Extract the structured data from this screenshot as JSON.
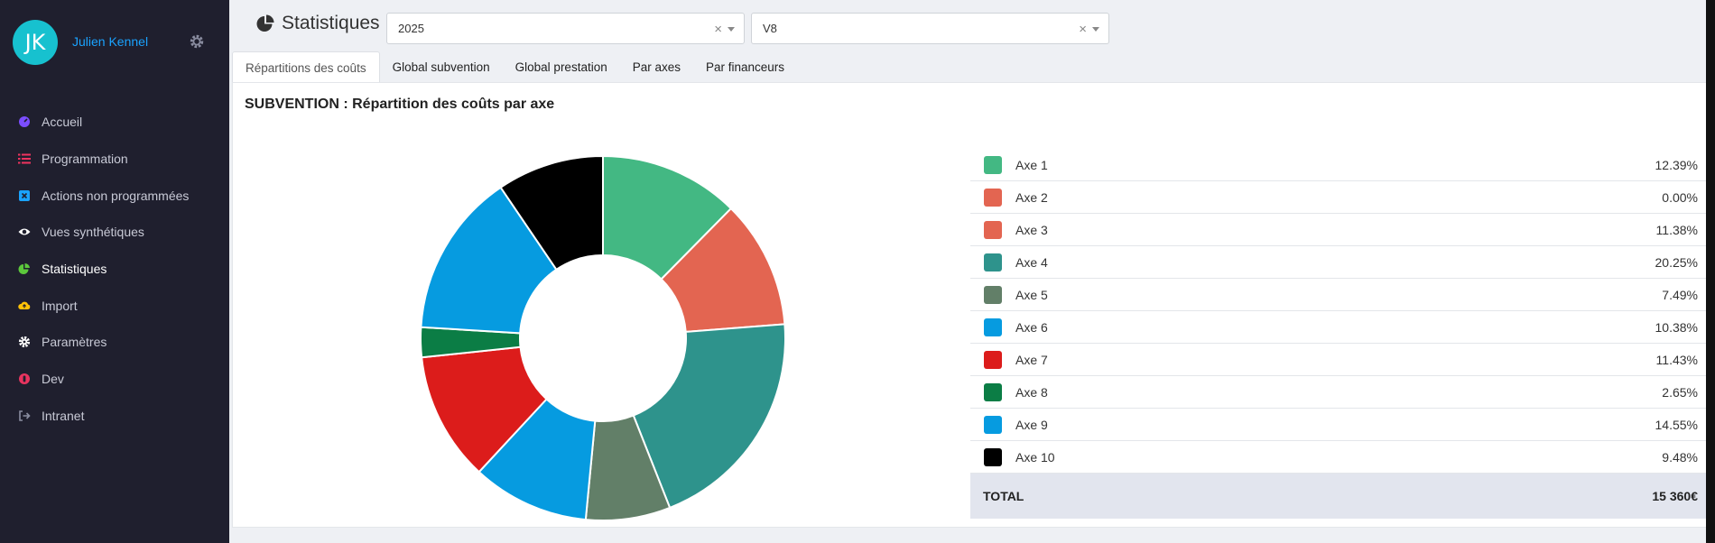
{
  "user": {
    "initials": "JK",
    "name": "Julien Kennel"
  },
  "nav": [
    {
      "label": "Accueil",
      "icon": "dashboard-icon",
      "color": "#7b4dff"
    },
    {
      "label": "Programmation",
      "icon": "list-icon",
      "color": "#f0335f"
    },
    {
      "label": "Actions non programmées",
      "icon": "square-x-icon",
      "color": "#1aa3ff"
    },
    {
      "label": "Vues synthétiques",
      "icon": "eye-icon",
      "color": "#ffffff"
    },
    {
      "label": "Statistiques",
      "icon": "pie-chart-icon",
      "color": "#5cc83c"
    },
    {
      "label": "Import",
      "icon": "cloud-upload-icon",
      "color": "#ffc107"
    },
    {
      "label": "Paramètres",
      "icon": "cog-icon",
      "color": "#ffffff"
    },
    {
      "label": "Dev",
      "icon": "bug-icon",
      "color": "#e8345f"
    },
    {
      "label": "Intranet",
      "icon": "sign-out-icon",
      "color": "#8a8da0"
    }
  ],
  "header": {
    "title": "Statistiques",
    "year_value": "2025",
    "version_value": "V8"
  },
  "tabs": [
    {
      "label": "Répartitions des coûts"
    },
    {
      "label": "Global subvention"
    },
    {
      "label": "Global prestation"
    },
    {
      "label": "Par axes"
    },
    {
      "label": "Par financeurs"
    }
  ],
  "panel_title": "SUBVENTION : Répartition des coûts par axe",
  "chart_data": {
    "type": "pie",
    "donut": true,
    "categories": [
      "Axe 1",
      "Axe 2",
      "Axe 3",
      "Axe 4",
      "Axe 5",
      "Axe 6",
      "Axe 7",
      "Axe 8",
      "Axe 9",
      "Axe 10"
    ],
    "values": [
      12.39,
      0.0,
      11.38,
      20.25,
      7.49,
      10.38,
      11.43,
      2.65,
      14.55,
      9.48
    ],
    "labels": [
      "12.39%",
      "0.00%",
      "11.38%",
      "20.25%",
      "7.49%",
      "10.38%",
      "11.43%",
      "2.65%",
      "14.55%",
      "9.48%"
    ],
    "colors": [
      "#43b883",
      "#e36551",
      "#e36551",
      "#2e938c",
      "#627f68",
      "#069be0",
      "#dc1c1b",
      "#0b7d45",
      "#069be0",
      "#000000"
    ],
    "total_label": "TOTAL",
    "total_value": "15 360€"
  }
}
